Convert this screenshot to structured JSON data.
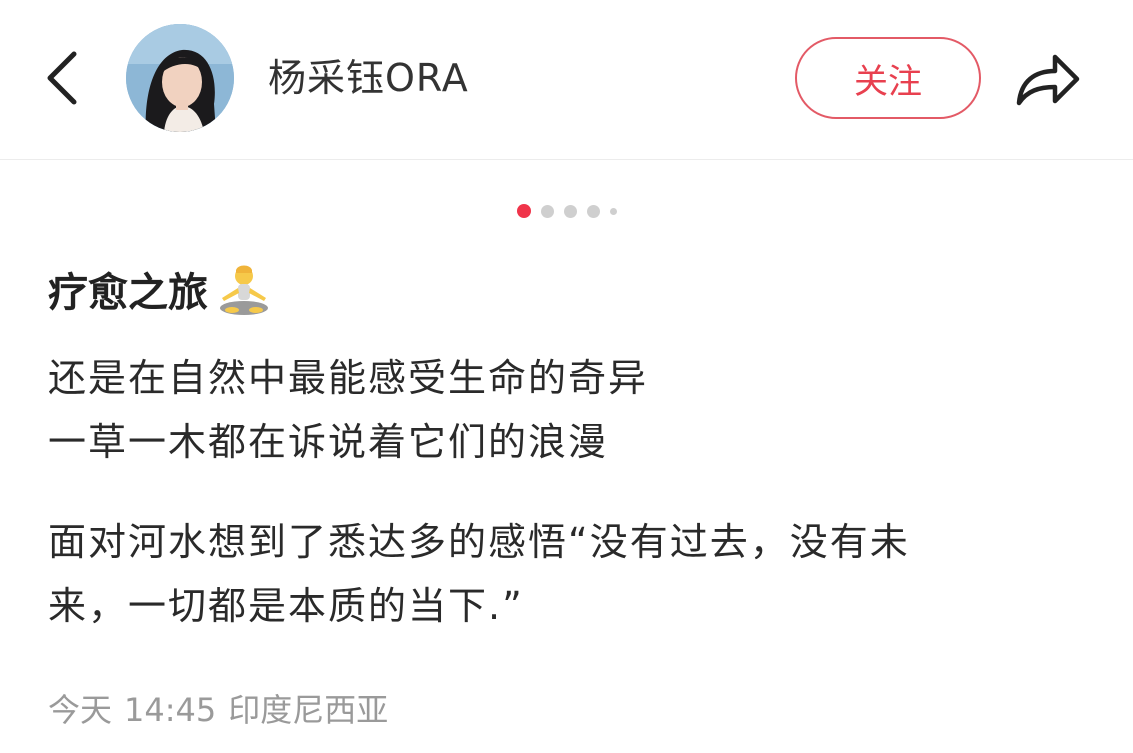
{
  "header": {
    "username": "杨采钰ORA",
    "follow_label": "关注"
  },
  "icons": {
    "back": "chevron-left-icon",
    "share": "share-arrow-icon",
    "title_emoji": "person-in-lotus-position-emoji"
  },
  "carousel": {
    "total": 5,
    "active_index": 0
  },
  "post": {
    "title": "疗愈之旅",
    "lines": [
      "还是在自然中最能感受生命的奇异",
      "一草一木都在诉说着它们的浪漫",
      "面对河水想到了悉达多的感悟“没有过去，没有未",
      "来，一切都是本质的当下.”"
    ]
  },
  "meta": {
    "date": "今天",
    "time": "14:45",
    "location": "印度尼西亚"
  },
  "colors": {
    "accent": "#e8404f",
    "dot_active": "#f0344a",
    "dot_inactive": "#cfcfcf",
    "meta_text": "#9a9a9a"
  }
}
